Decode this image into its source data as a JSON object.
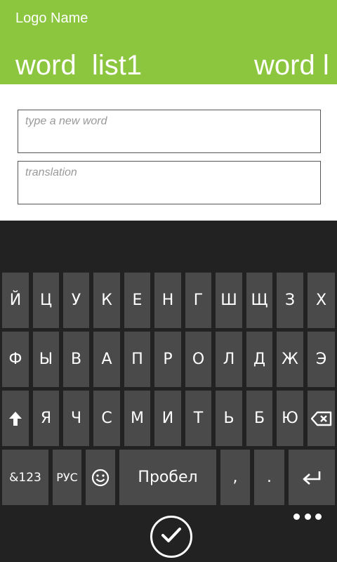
{
  "app": {
    "logo": "Logo Name",
    "pivot": [
      "word  list1",
      "word l"
    ]
  },
  "form": {
    "word_placeholder": "type a new word",
    "translation_placeholder": "translation"
  },
  "keyboard": {
    "row1": [
      "Й",
      "Ц",
      "У",
      "К",
      "Е",
      "Н",
      "Г",
      "Ш",
      "Щ",
      "З",
      "Х"
    ],
    "row2": [
      "Ф",
      "Ы",
      "В",
      "А",
      "П",
      "Р",
      "О",
      "Л",
      "Д",
      "Ж",
      "Э"
    ],
    "row3_letters": [
      "Я",
      "Ч",
      "С",
      "М",
      "И",
      "Т",
      "Ь",
      "Б",
      "Ю"
    ],
    "symbols_label": "&123",
    "lang_label": "РУС",
    "space_label": "Пробел",
    "comma_label": ",",
    "period_label": ".",
    "icons": {
      "shift": "shift-arrow-icon",
      "backspace": "backspace-icon",
      "emoji": "smiley-icon",
      "enter": "enter-arrow-icon",
      "more": "more-dots-icon",
      "check": "checkmark-icon"
    }
  },
  "colors": {
    "accent": "#8cc63f",
    "key": "#4a4a4a",
    "keyboard_bg": "#222222"
  }
}
